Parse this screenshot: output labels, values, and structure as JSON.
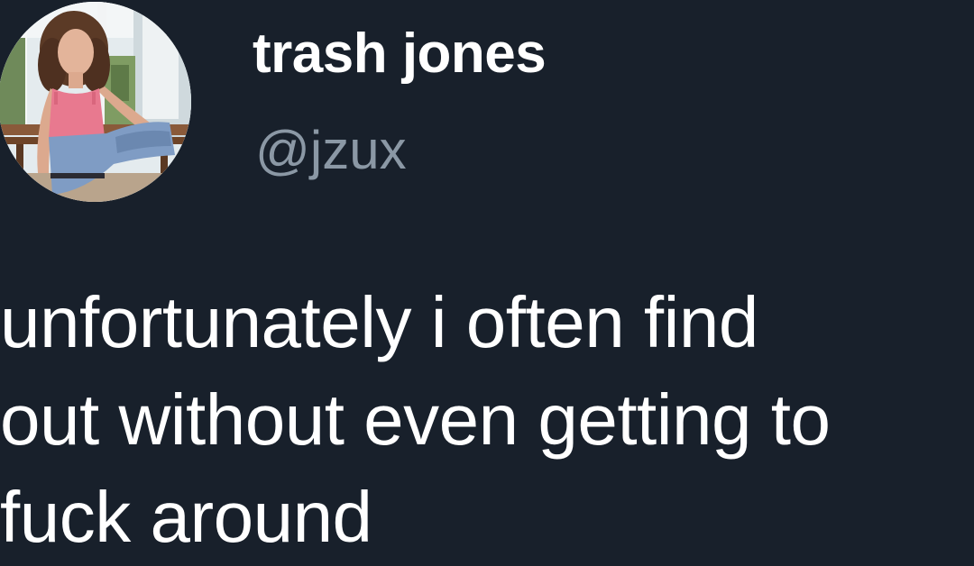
{
  "author": {
    "display_name": "trash jones",
    "handle": "@jzux",
    "avatar_icon": "profile-photo"
  },
  "tweet": {
    "text": "unfortunately i often find\nout without even getting to\nfuck around"
  },
  "colors": {
    "background": "#18202b",
    "name": "#ffffff",
    "handle": "#8b98a5",
    "text": "#ffffff"
  }
}
